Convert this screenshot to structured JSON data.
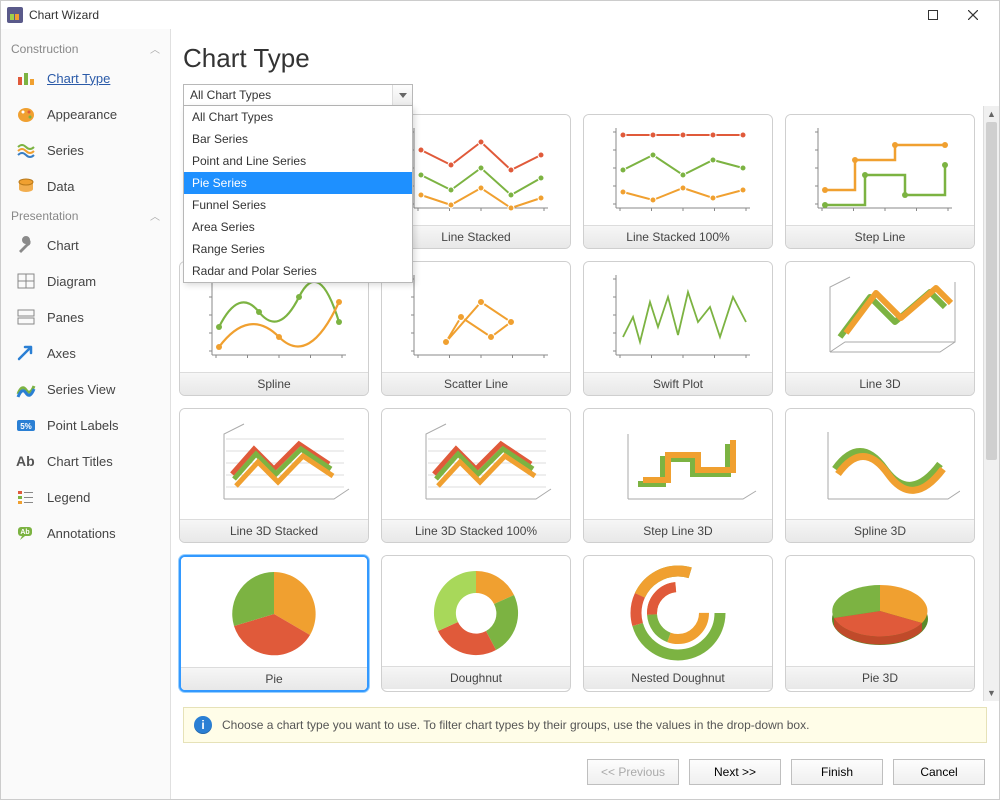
{
  "window": {
    "title": "Chart Wizard"
  },
  "sidebar": {
    "sections": [
      {
        "label": "Construction",
        "items": [
          {
            "id": "chart-type",
            "label": "Chart Type",
            "icon": "bars-icon",
            "selected": true
          },
          {
            "id": "appearance",
            "label": "Appearance",
            "icon": "palette-icon"
          },
          {
            "id": "series",
            "label": "Series",
            "icon": "waves-icon"
          },
          {
            "id": "data",
            "label": "Data",
            "icon": "database-icon"
          }
        ]
      },
      {
        "label": "Presentation",
        "items": [
          {
            "id": "chart",
            "label": "Chart",
            "icon": "wrench-icon"
          },
          {
            "id": "diagram",
            "label": "Diagram",
            "icon": "grid-icon"
          },
          {
            "id": "panes",
            "label": "Panes",
            "icon": "panes-icon"
          },
          {
            "id": "axes",
            "label": "Axes",
            "icon": "arrow-icon"
          },
          {
            "id": "series-view",
            "label": "Series View",
            "icon": "ribbon-icon"
          },
          {
            "id": "point-labels",
            "label": "Point Labels",
            "icon": "percent-icon"
          },
          {
            "id": "chart-titles",
            "label": "Chart Titles",
            "icon": "text-icon"
          },
          {
            "id": "legend",
            "label": "Legend",
            "icon": "legend-icon"
          },
          {
            "id": "annotations",
            "label": "Annotations",
            "icon": "annotation-icon"
          }
        ]
      }
    ]
  },
  "page": {
    "title": "Chart Type"
  },
  "filter": {
    "selected": "All Chart Types",
    "highlighted_index": 4,
    "options": [
      "All Chart Types",
      "Bar Series",
      "Point and Line Series",
      "Pie Series",
      "Funnel Series",
      "Area Series",
      "Range Series",
      "Radar and Polar Series"
    ]
  },
  "charts": [
    {
      "label": "Line Stacked",
      "kind": "line-multi"
    },
    {
      "label": "Line Stacked 100%",
      "kind": "line-multi-flat"
    },
    {
      "label": "Step Line",
      "kind": "step-line"
    },
    {
      "label": "Spline",
      "kind": "spline"
    },
    {
      "label": "Scatter Line",
      "kind": "scatter"
    },
    {
      "label": "Swift Plot",
      "kind": "swift"
    },
    {
      "label": "Line 3D",
      "kind": "line3d"
    },
    {
      "label": "Line 3D Stacked",
      "kind": "line3d-multi"
    },
    {
      "label": "Line 3D Stacked 100%",
      "kind": "line3d-multi"
    },
    {
      "label": "Step Line 3D",
      "kind": "step3d"
    },
    {
      "label": "Spline 3D",
      "kind": "spline3d"
    },
    {
      "label": "Pie",
      "kind": "pie",
      "selected": true
    },
    {
      "label": "Doughnut",
      "kind": "doughnut"
    },
    {
      "label": "Nested Doughnut",
      "kind": "nested-doughnut"
    },
    {
      "label": "Pie 3D",
      "kind": "pie3d"
    }
  ],
  "hint": "Choose a chart type you want to use. To filter chart types by their groups, use the values in the drop-down box.",
  "buttons": {
    "previous": "<< Previous",
    "next": "Next >>",
    "finish": "Finish",
    "cancel": "Cancel"
  },
  "colors": {
    "green": "#7cb342",
    "orange": "#f0a030",
    "red": "#e05a3a",
    "lime": "#a8d85a"
  }
}
